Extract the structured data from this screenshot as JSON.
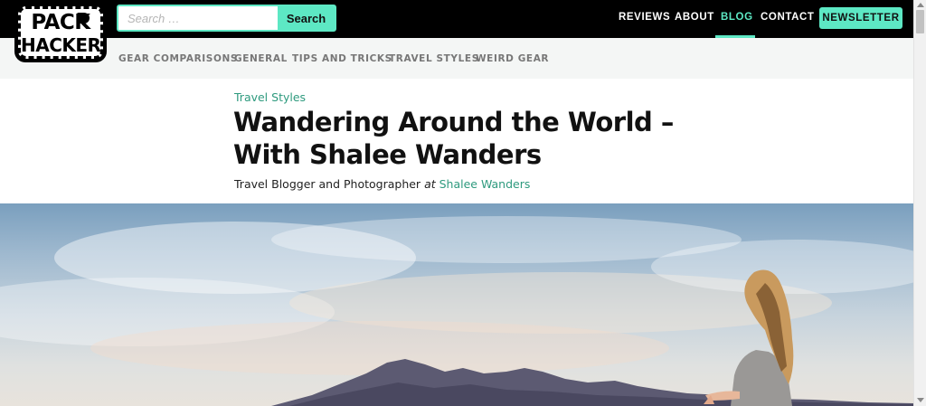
{
  "logo": {
    "line1": "PACK",
    "line2": "HACKER"
  },
  "search": {
    "placeholder": "Search …",
    "value": "",
    "button_label": "Search"
  },
  "nav": {
    "items": [
      {
        "label": "REVIEWS",
        "active": false
      },
      {
        "label": "ABOUT",
        "active": false
      },
      {
        "label": "BLOG",
        "active": true
      },
      {
        "label": "CONTACT",
        "active": false
      }
    ],
    "newsletter_label": "NEWSLETTER"
  },
  "subnav": {
    "items": [
      {
        "label": "GEAR COMPARISONS"
      },
      {
        "label": "GENERAL"
      },
      {
        "label": "TIPS AND TRICKS"
      },
      {
        "label": "TRAVEL STYLES"
      },
      {
        "label": "WEIRD GEAR"
      }
    ]
  },
  "article": {
    "category": "Travel Styles",
    "title": "Wandering Around the World – With Shalee Wanders",
    "byline": {
      "role": "Travel Blogger and Photographer",
      "at": "at",
      "author": "Shalee Wanders"
    }
  },
  "colors": {
    "accent": "#5de8c4",
    "link": "#2e9a7e",
    "topbar": "#000000",
    "subnav_bg": "#f4f6f5"
  },
  "icons": {
    "scroll_up": "chevron-up-icon",
    "scroll_down": "chevron-down-icon"
  }
}
